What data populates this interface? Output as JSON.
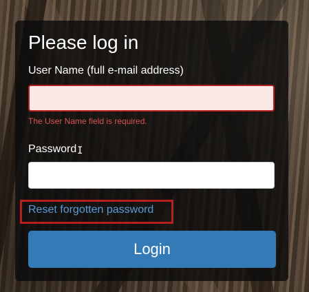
{
  "form": {
    "title": "Please log in",
    "username_label": "User Name (full e-mail address)",
    "username_value": "",
    "username_error": "The User Name field is required.",
    "password_label": "Password",
    "password_value": "",
    "reset_link": "Reset forgotten password",
    "login_button": "Login"
  },
  "colors": {
    "error": "#d9534f",
    "error_border": "#b51f1f",
    "primary": "#337ab7",
    "link": "#5b9bd5"
  }
}
